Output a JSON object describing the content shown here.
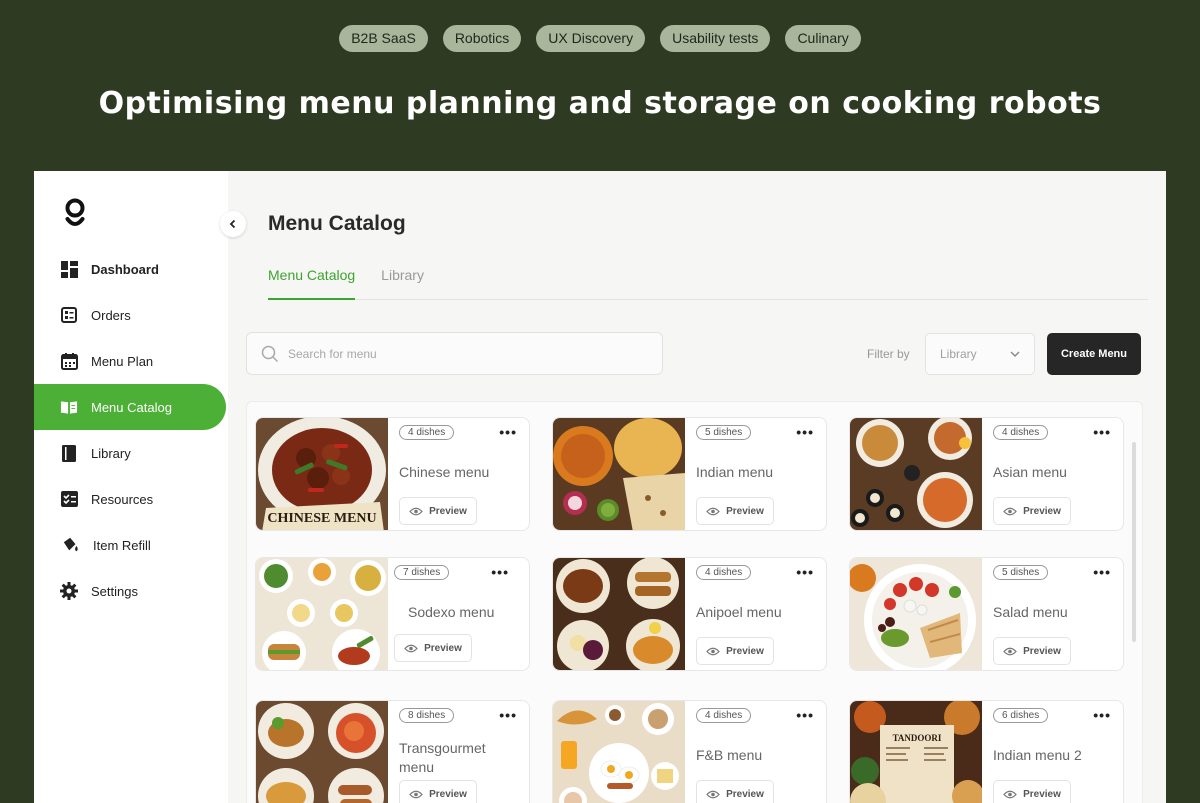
{
  "hero": {
    "tags": [
      "B2B SaaS",
      "Robotics",
      "UX Discovery",
      "Usability tests",
      "Culinary"
    ],
    "title": "Optimising menu planning and storage on cooking robots"
  },
  "sidebar": {
    "items": [
      {
        "label": "Dashboard",
        "icon": "dashboard-icon"
      },
      {
        "label": "Orders",
        "icon": "orders-icon"
      },
      {
        "label": "Menu Plan",
        "icon": "calendar-icon"
      },
      {
        "label": "Menu Catalog",
        "icon": "book-icon",
        "active": true
      },
      {
        "label": "Library",
        "icon": "library-icon"
      },
      {
        "label": "Resources",
        "icon": "resources-icon"
      },
      {
        "label": "Item Refill",
        "icon": "refill-icon"
      },
      {
        "label": "Settings",
        "icon": "gear-icon"
      }
    ]
  },
  "main": {
    "title": "Menu Catalog",
    "tabs": [
      "Menu Catalog",
      "Library"
    ],
    "search_placeholder": "Search for menu",
    "filter_label": "Filter by",
    "filter_value": "Library",
    "create_label": "Create Menu",
    "preview_label": "Preview",
    "cards": [
      {
        "dishes": "4 dishes",
        "name": "Chinese menu",
        "photo_text": "CHINESE MENU"
      },
      {
        "dishes": "5 dishes",
        "name": "Indian menu"
      },
      {
        "dishes": "4 dishes",
        "name": "Asian menu"
      },
      {
        "dishes": "7 dishes",
        "name": "Sodexo menu"
      },
      {
        "dishes": "4 dishes",
        "name": "Anipoel menu"
      },
      {
        "dishes": "5 dishes",
        "name": "Salad menu"
      },
      {
        "dishes": "8 dishes",
        "name": "Transgourmet menu"
      },
      {
        "dishes": "4 dishes",
        "name": "F&B menu"
      },
      {
        "dishes": "6 dishes",
        "name": "Indian menu 2",
        "photo_text": "TANDOORI"
      }
    ]
  },
  "colors": {
    "background": "#2f3a23",
    "tag": "#a9b69b",
    "accent": "#4caf36",
    "button_dark": "#262626"
  }
}
